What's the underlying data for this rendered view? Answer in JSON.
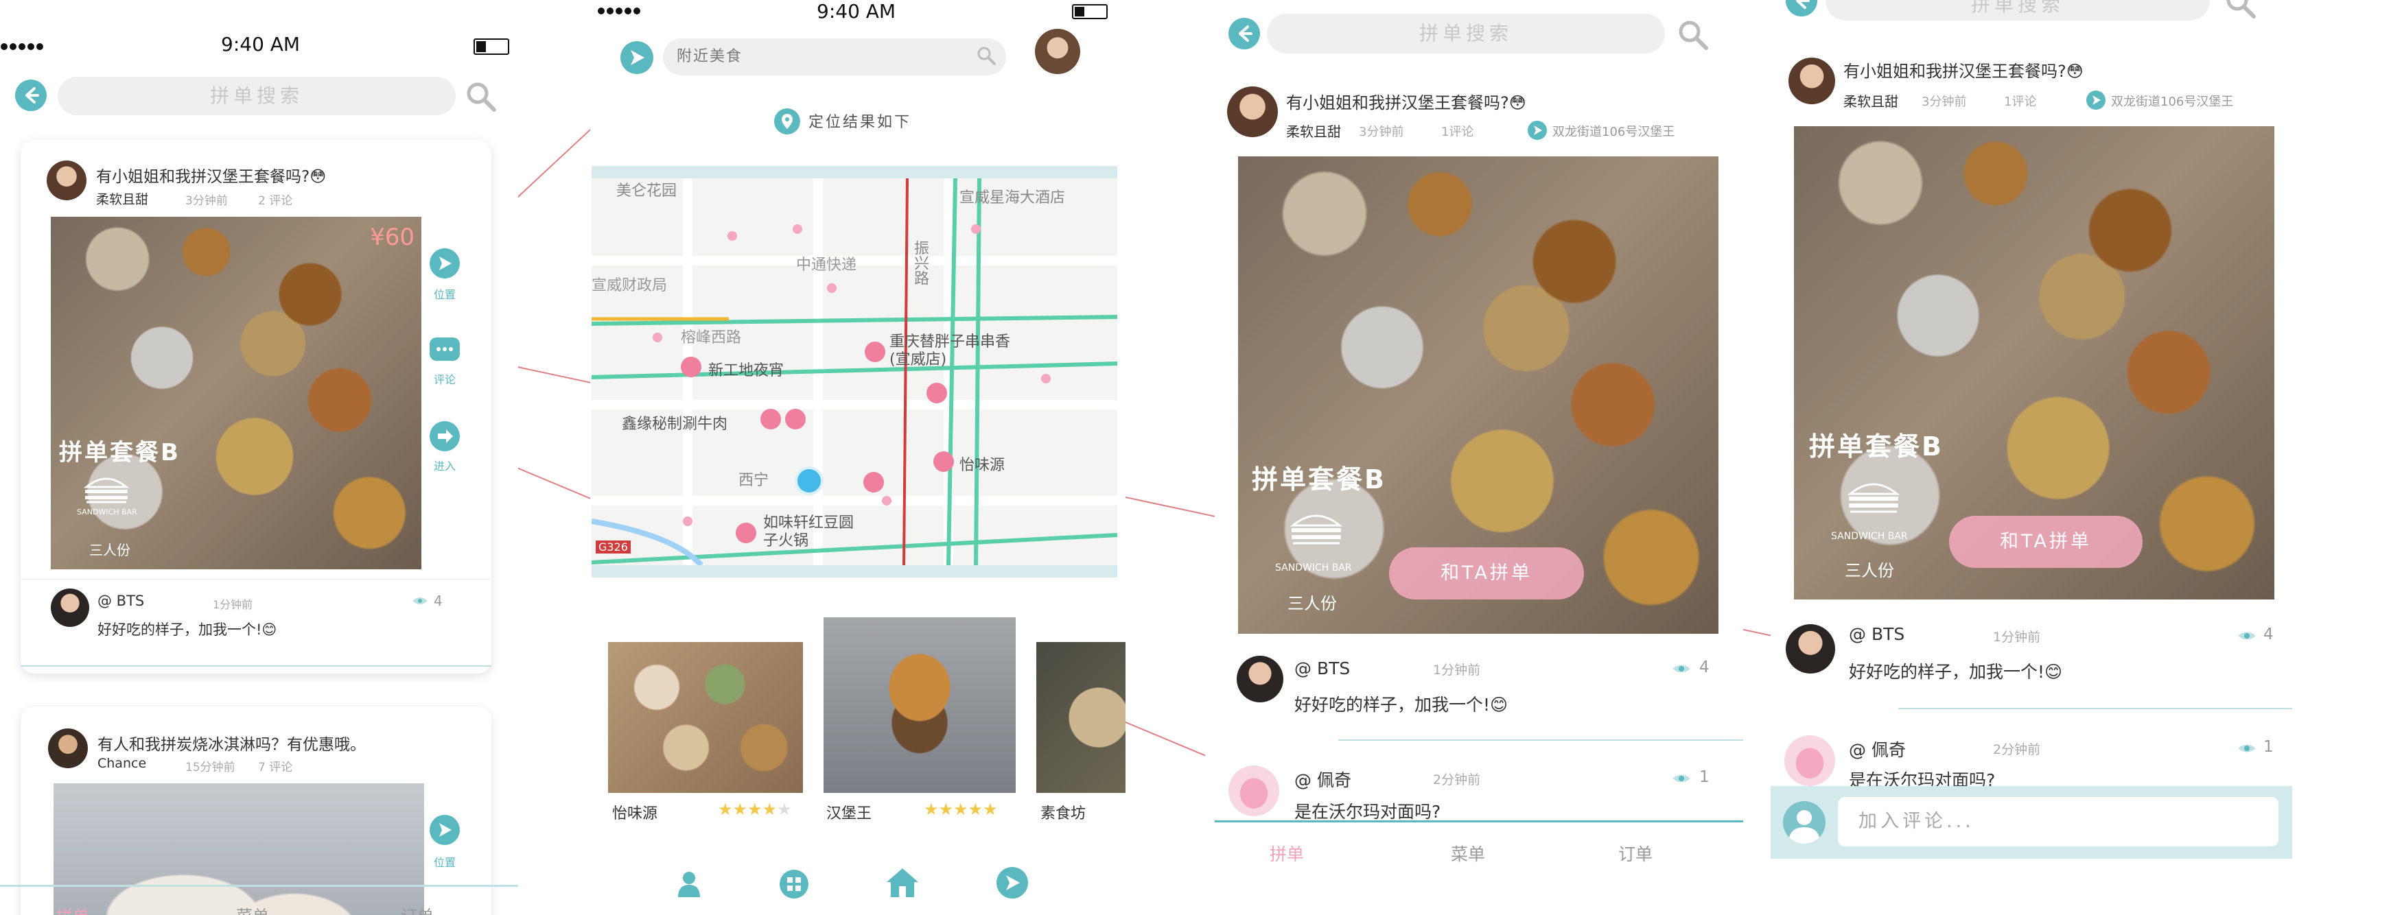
{
  "colors": {
    "teal": "#5ab9c0",
    "pink": "#f2a3b7",
    "price": "#ff9a9a",
    "line": "#e07f82"
  },
  "status": {
    "time": "9:40 AM"
  },
  "screen1": {
    "search_placeholder": "拼单搜索",
    "post1": {
      "title": "有小姐姐和我拼汉堡王套餐吗?😳",
      "user": "柔软且甜",
      "time": "3分钟前",
      "comments": "2 评论",
      "price": "¥60",
      "set_name": "拼单套餐B",
      "brand": "SANDWICH BAR",
      "portion": "三人份",
      "actions": [
        "位置",
        "评论",
        "进入"
      ],
      "comment": {
        "user": "@ BTS",
        "time": "1分钟前",
        "views": "4",
        "text": "好好吃的样子，加我一个!😊"
      }
    },
    "post2": {
      "title": "有人和我拼炭烧冰淇淋吗？有优惠哦。",
      "user": "Chance",
      "time": "15分钟前",
      "comments": "7 评论",
      "action": "位置"
    },
    "tabs": [
      "拼单",
      "菜单",
      "订单"
    ]
  },
  "screen2": {
    "search_placeholder": "附近美食",
    "location_result": "定位结果如下",
    "map_labels": [
      "美仑花园",
      "宣威星海大酒店",
      "中通快递",
      "振兴路",
      "宣威财政局",
      "榕峰西路",
      "新工地夜宵",
      "重庆替胖子串串香(宣威店)",
      "鑫缘秘制涮牛肉",
      "怡味源",
      "西宁",
      "如味轩红豆圆子火锅",
      "G326"
    ],
    "restaurants": [
      {
        "name": "怡味源",
        "rating": 4
      },
      {
        "name": "汉堡王",
        "rating": 5
      },
      {
        "name": "素食坊",
        "rating": 0
      }
    ]
  },
  "screen3": {
    "search_placeholder": "拼单搜索",
    "post": {
      "title": "有小姐姐和我拼汉堡王套餐吗?😳",
      "user": "柔软且甜",
      "time": "3分钟前",
      "comments": "1评论",
      "location": "双龙街道106号汉堡王",
      "set_name": "拼单套餐B",
      "brand": "SANDWICH BAR",
      "portion": "三人份",
      "join_button": "和TA拼单"
    },
    "comments": [
      {
        "user": "@ BTS",
        "time": "1分钟前",
        "views": "4",
        "text": "好好吃的样子，加我一个!😊"
      },
      {
        "user": "@ 佩奇",
        "time": "2分钟前",
        "views": "1",
        "text": "是在沃尔玛对面吗?"
      }
    ],
    "tabs": [
      "拼单",
      "菜单",
      "订单"
    ]
  },
  "screen4": {
    "search_placeholder": "拼单搜索",
    "post": {
      "title": "有小姐姐和我拼汉堡王套餐吗?😳",
      "user": "柔软且甜",
      "time": "3分钟前",
      "comments": "1评论",
      "location": "双龙街道106号汉堡王",
      "set_name": "拼单套餐B",
      "brand": "SANDWICH BAR",
      "portion": "三人份",
      "join_button": "和TA拼单"
    },
    "comments": [
      {
        "user": "@ BTS",
        "time": "1分钟前",
        "views": "4",
        "text": "好好吃的样子，加我一个!😊"
      },
      {
        "user": "@ 佩奇",
        "time": "2分钟前",
        "views": "1",
        "text": "是在沃尔玛对面吗?"
      }
    ],
    "comment_placeholder": "加入评论..."
  }
}
